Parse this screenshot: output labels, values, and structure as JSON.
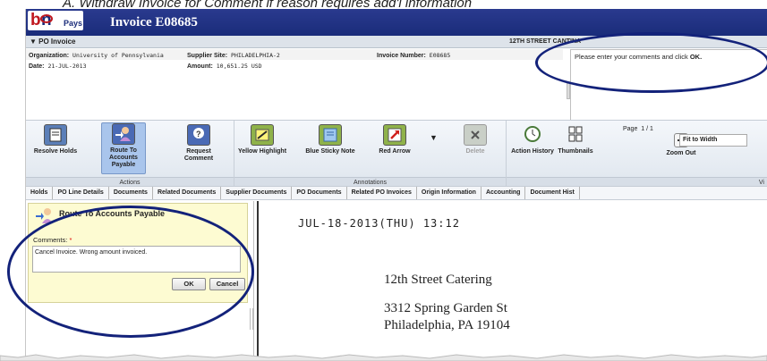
{
  "caption": "A. Withdraw Invoice for Comment if reason requires add'l information",
  "app": {
    "logo_b": "b",
    "logo_n": "n",
    "logo_pays": "Pays",
    "title": "Invoice E08685"
  },
  "po_header": {
    "toggle": "▼ PO Invoice",
    "supplier_name": "12TH STREET CANTINA"
  },
  "info": {
    "organization_label": "Organization:",
    "organization_value": "University of Pennsylvania",
    "supplier_site_label": "Supplier Site:",
    "supplier_site_value": "PHILADELPHIA-2",
    "invoice_number_label": "Invoice Number:",
    "invoice_number_value": "E08685",
    "date_label": "Date:",
    "date_value": "21-JUL-2013",
    "amount_label": "Amount:",
    "amount_value": "10,651.25 USD"
  },
  "comment_box": {
    "text": "Please enter your comments and click ",
    "bold": "OK."
  },
  "toolbar": {
    "actions_label": "Actions",
    "annotations_label": "Annotations",
    "view_label": "Vi",
    "resolve_holds": "Resolve Holds",
    "route_to_ap": "Route To Accounts Payable",
    "request_comment": "Request Comment",
    "yellow_highlight": "Yellow Highlight",
    "blue_sticky": "Blue Sticky Note",
    "red_arrow": "Red Arrow",
    "delete": "Delete",
    "action_history": "Action History",
    "thumbnails": "Thumbnails",
    "zoom_out": "Zoom Out",
    "page_label": "Page",
    "page_value": "1 / 1",
    "fit_select": "Fit to Width",
    "dropdown_arrow": "▼"
  },
  "tabs": [
    "Holds",
    "PO Line Details",
    "Documents",
    "Related Documents",
    "Supplier Documents",
    "PO Documents",
    "Related PO Invoices",
    "Origin Information",
    "Accounting",
    "Document Hist"
  ],
  "route_panel": {
    "title": "Route To Accounts Payable",
    "comments_label": "Comments:",
    "required_mark": "*",
    "comment_value": "Cancel Invoice.  Wrong amount invoiced.",
    "ok_label": "OK",
    "cancel_label": "Cancel"
  },
  "document": {
    "stamp": "JUL-18-2013(THU)  13:12",
    "line1": "12th Street Catering",
    "line2": "3312 Spring Garden St",
    "line3": "Philadelphia, PA 19104"
  },
  "colors": {
    "title_bar": "#1a2c7a",
    "oval": "#13227a",
    "route_panel_bg": "#fdfbd2",
    "active_tool": "#a9c5ec"
  }
}
